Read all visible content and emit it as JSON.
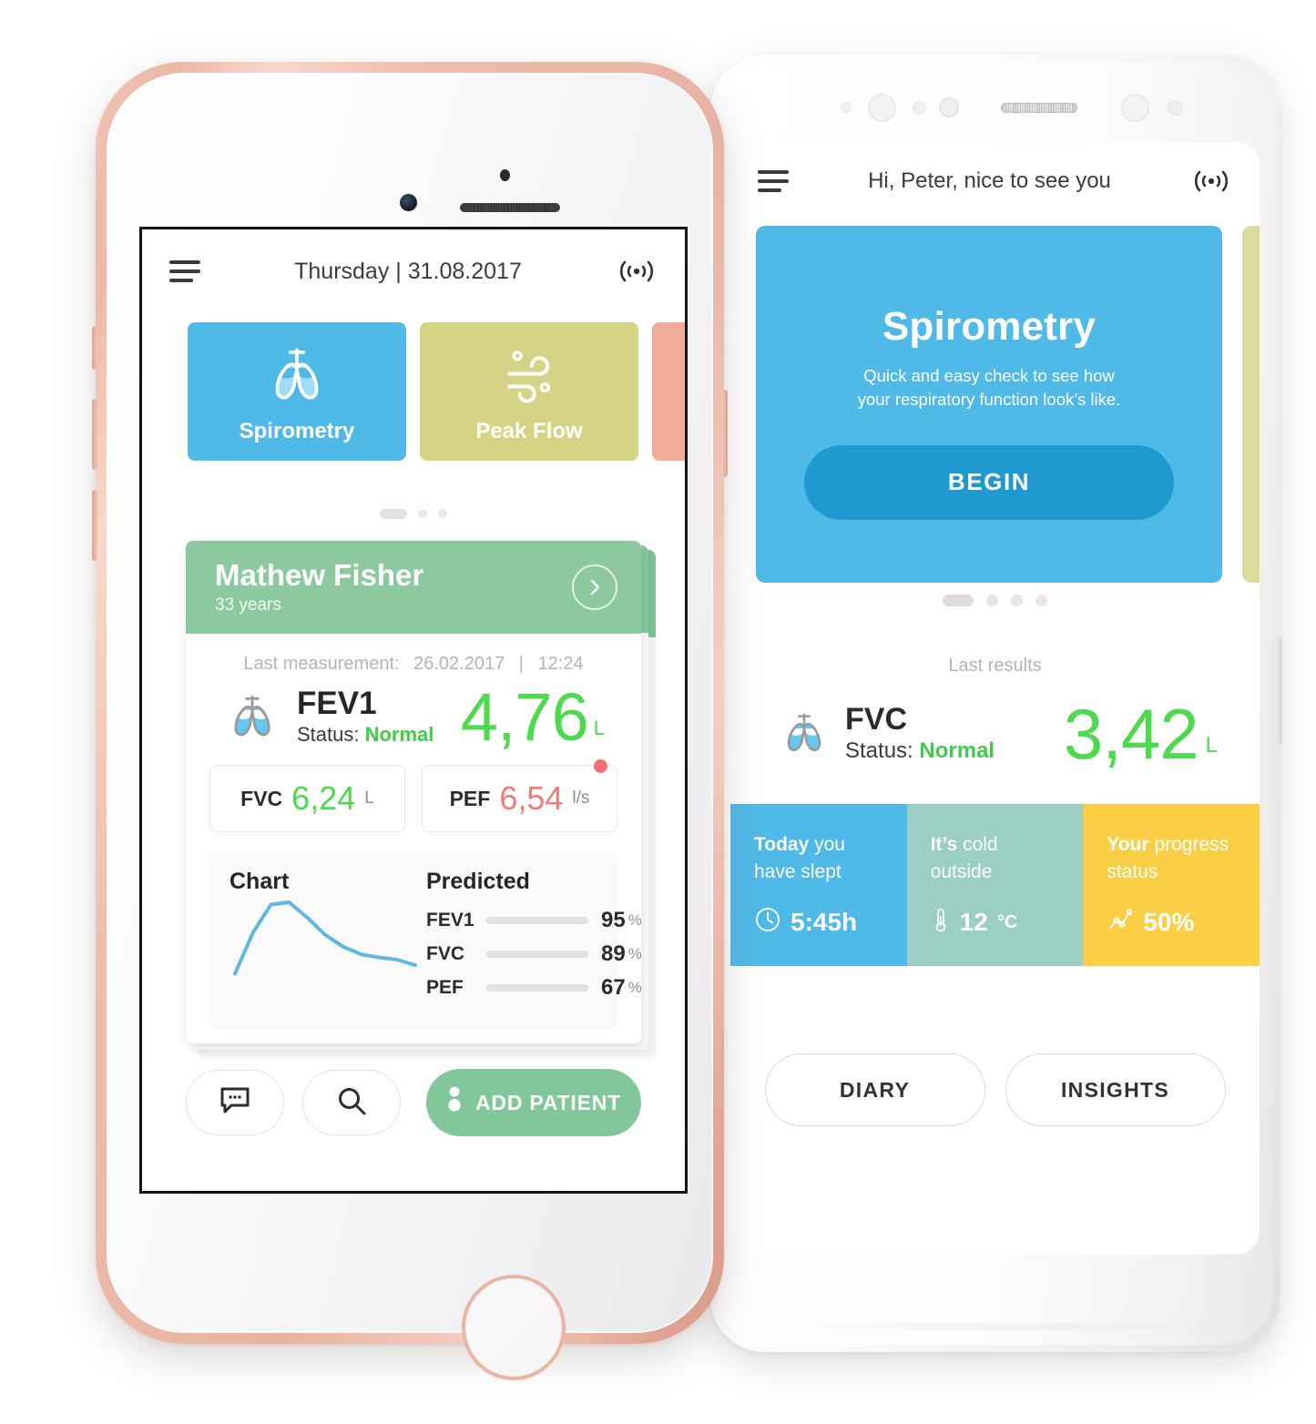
{
  "doctor_app": {
    "header": {
      "menu_icon": "hamburger-menu-icon",
      "title": "Thursday | 31.08.2017",
      "signal_icon": "wireless-signal-icon"
    },
    "module_tiles": [
      {
        "label": "Spirometry",
        "color": "#4fb9e8",
        "icon": "lungs-icon"
      },
      {
        "label": "Peak Flow",
        "color": "#d5d484",
        "icon": "wind-icon"
      },
      {
        "label": "",
        "color": "#f0ab9b",
        "icon": ""
      }
    ],
    "carousel": {
      "total": 3,
      "active": 0
    },
    "patient": {
      "name": "Mathew Fisher",
      "age": "33 years",
      "chevron_icon": "chevron-right-icon",
      "last_measurement_label": "Last measurement:",
      "last_measurement_date": "26.02.2017",
      "last_measurement_sep": "|",
      "last_measurement_time": "12:24",
      "primary": {
        "icon": "lungs-icon",
        "key": "FEV1",
        "status_label": "Status:",
        "status_value": "Normal",
        "value": "4,76",
        "unit": "L"
      },
      "secondary": [
        {
          "key": "FVC",
          "value": "6,24",
          "unit": "L",
          "state": "green",
          "alert": false
        },
        {
          "key": "PEF",
          "value": "6,54",
          "unit": "l/s",
          "state": "red",
          "alert": true
        }
      ],
      "chart_heading": "Chart",
      "predicted_heading": "Predicted"
    },
    "actions": {
      "chat_icon": "chat-bubble-icon",
      "search_icon": "search-icon",
      "add_patient_icon": "person-icon",
      "add_patient_label": "ADD PATIENT"
    }
  },
  "patient_app": {
    "header": {
      "menu_icon": "hamburger-menu-icon",
      "title": "Hi, Peter, nice to see you",
      "signal_icon": "wireless-signal-icon"
    },
    "hero": {
      "title": "Spirometry",
      "subtitle_line1": "Quick and easy check to see how",
      "subtitle_line2": "your respiratory function look’s like.",
      "button_label": "BEGIN",
      "bg_color": "#4fb9e8",
      "button_color": "#1f9ad1",
      "peek_color": "#dcdb9e"
    },
    "carousel": {
      "total": 4,
      "active": 0
    },
    "results": {
      "heading": "Last results",
      "icon": "lungs-icon",
      "key": "FVC",
      "status_label": "Status:",
      "status_value": "Normal",
      "value": "3,42",
      "unit": "L"
    },
    "info_tiles": [
      {
        "strong": "Today",
        "rest": " you",
        "line2": "have slept",
        "icon": "clock-icon",
        "value": "5:45h",
        "unit": "",
        "color": "#4fb9e8"
      },
      {
        "strong": "It’s",
        "rest": " cold",
        "line2": "outside",
        "icon": "thermometer-icon",
        "value": "12",
        "unit": "°C",
        "color": "#9bcfc3"
      },
      {
        "strong": "Your",
        "rest": " progress",
        "line2": "status",
        "icon": "graph-icon",
        "value": "50%",
        "unit": "",
        "color": "#fbcf45"
      }
    ],
    "footer_buttons": [
      {
        "label": "DIARY"
      },
      {
        "label": "INSIGHTS"
      }
    ]
  },
  "chart_data": {
    "type": "line",
    "title": "Chart",
    "xlabel": "",
    "ylabel": "",
    "x": [
      0,
      1,
      2,
      3,
      4,
      5,
      6,
      7,
      8,
      9,
      10
    ],
    "y": [
      8,
      46,
      72,
      74,
      60,
      44,
      33,
      26,
      23,
      21,
      16
    ],
    "line_color": "#5fb8e0",
    "grid": false,
    "legend": "none",
    "predicted": {
      "type": "bar",
      "categories": [
        "FEV1",
        "FVC",
        "PEF"
      ],
      "values": [
        95,
        89,
        67
      ],
      "unit": "%",
      "colors": [
        "#4ccc3e",
        "#d9d338",
        "#f48e8d"
      ],
      "xlim": [
        0,
        100
      ]
    }
  }
}
